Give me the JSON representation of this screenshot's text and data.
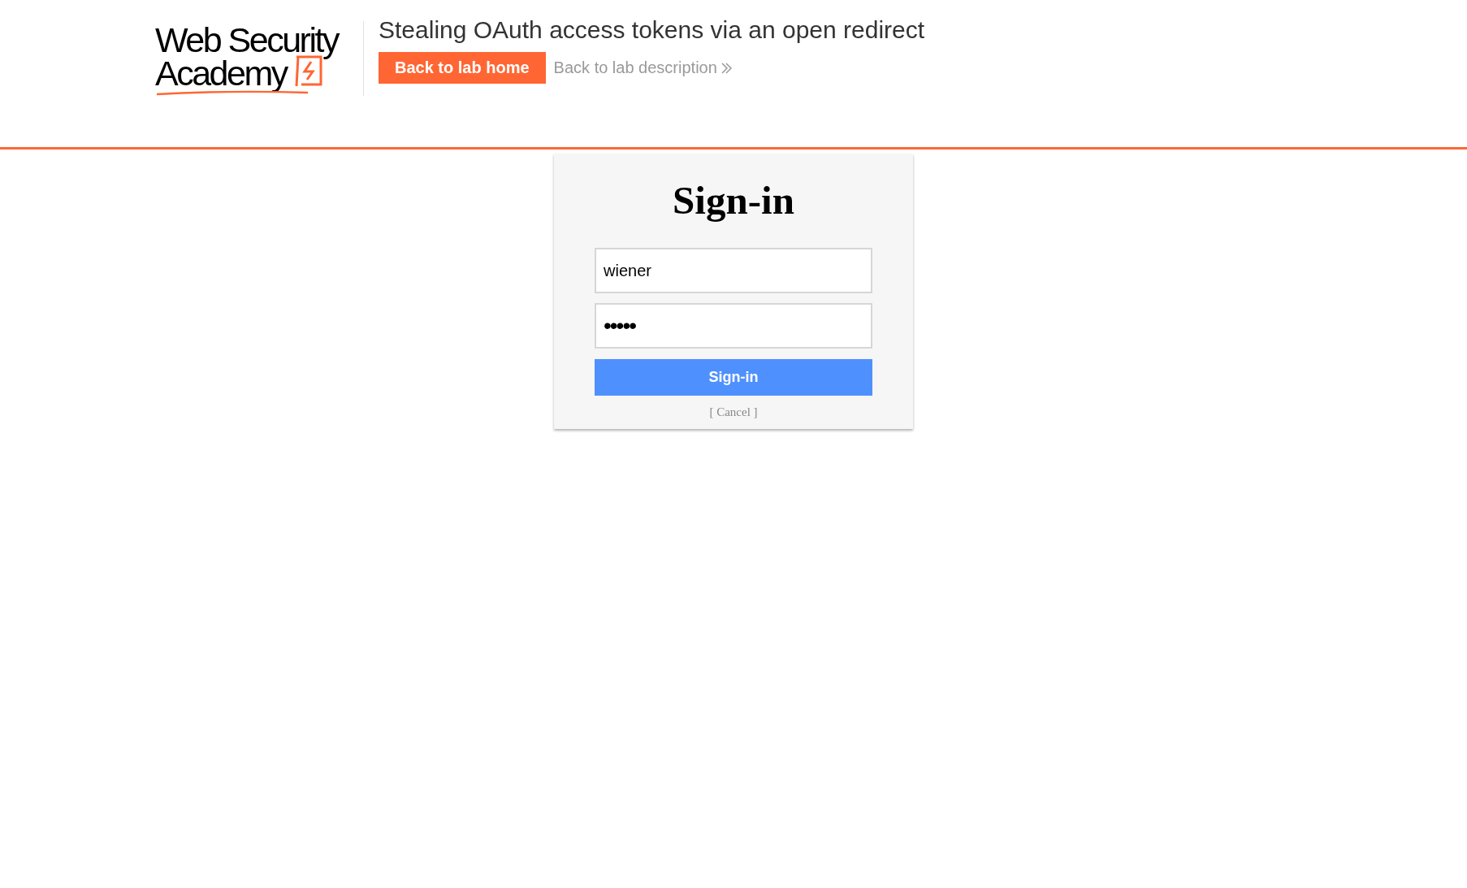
{
  "header": {
    "logo": {
      "line_1": "Web Security",
      "line_2": "Academy"
    },
    "lab_title": "Stealing OAuth access tokens via an open redirect",
    "back_to_lab_home": "Back to lab home",
    "back_to_lab_description": "Back to lab description"
  },
  "sign_in_card": {
    "heading": "Sign-in",
    "username_field": {
      "value": "wiener"
    },
    "password_field": {
      "value": "•••••"
    },
    "submit_button": "Sign-in",
    "cancel_link": "[ Cancel ]"
  }
}
